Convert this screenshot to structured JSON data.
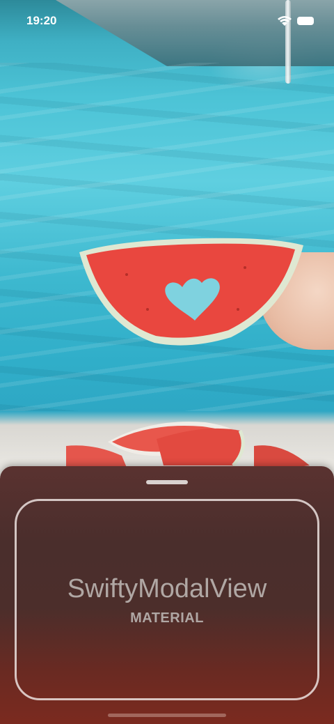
{
  "status_bar": {
    "time": "19:20"
  },
  "modal": {
    "title": "SwiftyModalView",
    "subtitle": "MATERIAL"
  },
  "colors": {
    "modal_top": "#5a3230",
    "modal_bottom": "#7b2a1f",
    "pool_water": "#4cc3d6",
    "watermelon": "#e8473f",
    "modal_text": "#b0a7a4"
  }
}
